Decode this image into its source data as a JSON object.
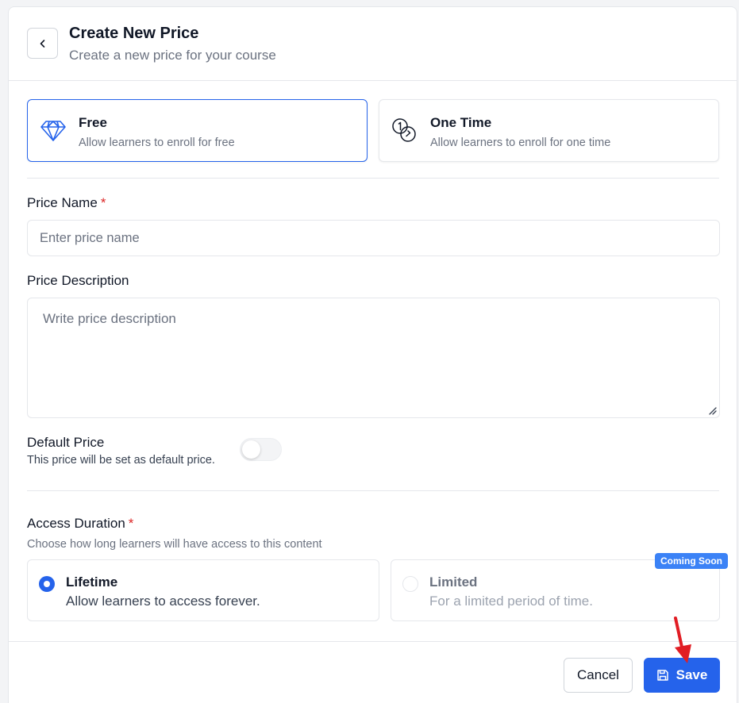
{
  "header": {
    "back_icon": "chevron-left-icon",
    "title": "Create New Price",
    "subtitle": "Create a new price for your course"
  },
  "price_types": [
    {
      "icon": "diamond-icon",
      "title": "Free",
      "description": "Allow learners to enroll for free",
      "selected": true
    },
    {
      "icon": "coins-icon",
      "title": "One Time",
      "description": "Allow learners to enroll for one time",
      "selected": false
    }
  ],
  "price_name": {
    "label": "Price Name",
    "required_mark": "*",
    "value": "",
    "placeholder": "Enter price name"
  },
  "price_description": {
    "label": "Price Description",
    "value": "",
    "placeholder": "Write price description"
  },
  "default_price": {
    "label": "Default Price",
    "description": "This price will be set as default price.",
    "enabled": false
  },
  "access_duration": {
    "label": "Access Duration",
    "required_mark": "*",
    "description": "Choose how long learners will have access to this content",
    "options": [
      {
        "title": "Lifetime",
        "description": "Allow learners to access forever.",
        "selected": true,
        "disabled": false
      },
      {
        "title": "Limited",
        "description": "For a limited period of time.",
        "selected": false,
        "disabled": true,
        "badge": "Coming Soon"
      }
    ]
  },
  "footer": {
    "cancel_label": "Cancel",
    "save_label": "Save",
    "save_icon": "save-icon"
  },
  "colors": {
    "accent": "#2563eb",
    "badge": "#3b82f6",
    "required": "#dc2626",
    "annotation_arrow": "#e11d24"
  }
}
